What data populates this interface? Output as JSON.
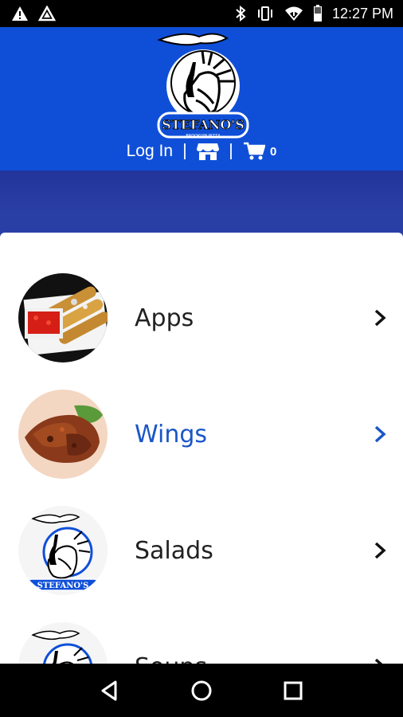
{
  "status_bar": {
    "time": "12:27 PM",
    "left_icons": [
      "warning-icon",
      "nav-arrow-icon"
    ],
    "right_icons": [
      "bluetooth-icon",
      "vibrate-icon",
      "wifi-icon",
      "battery-icon"
    ]
  },
  "header": {
    "background": "#0f4fd8",
    "logo_text": "STEFANO'S",
    "logo_subtext": "BROOKLYN PIZZA",
    "login_label": "Log In",
    "store_icon": "store-icon",
    "cart_icon": "cart-icon",
    "cart_count": "0"
  },
  "menu": {
    "accent": "#1a56c8",
    "items": [
      {
        "label": "Apps",
        "icon": "apps-photo"
      },
      {
        "label": "Wings",
        "icon": "wings-photo",
        "active": true
      },
      {
        "label": "Salads",
        "icon": "logo-thumb"
      },
      {
        "label": "Soups",
        "icon": "logo-thumb"
      }
    ]
  },
  "navigation_bar": {
    "buttons": [
      "back-icon",
      "home-icon",
      "recents-icon"
    ]
  }
}
